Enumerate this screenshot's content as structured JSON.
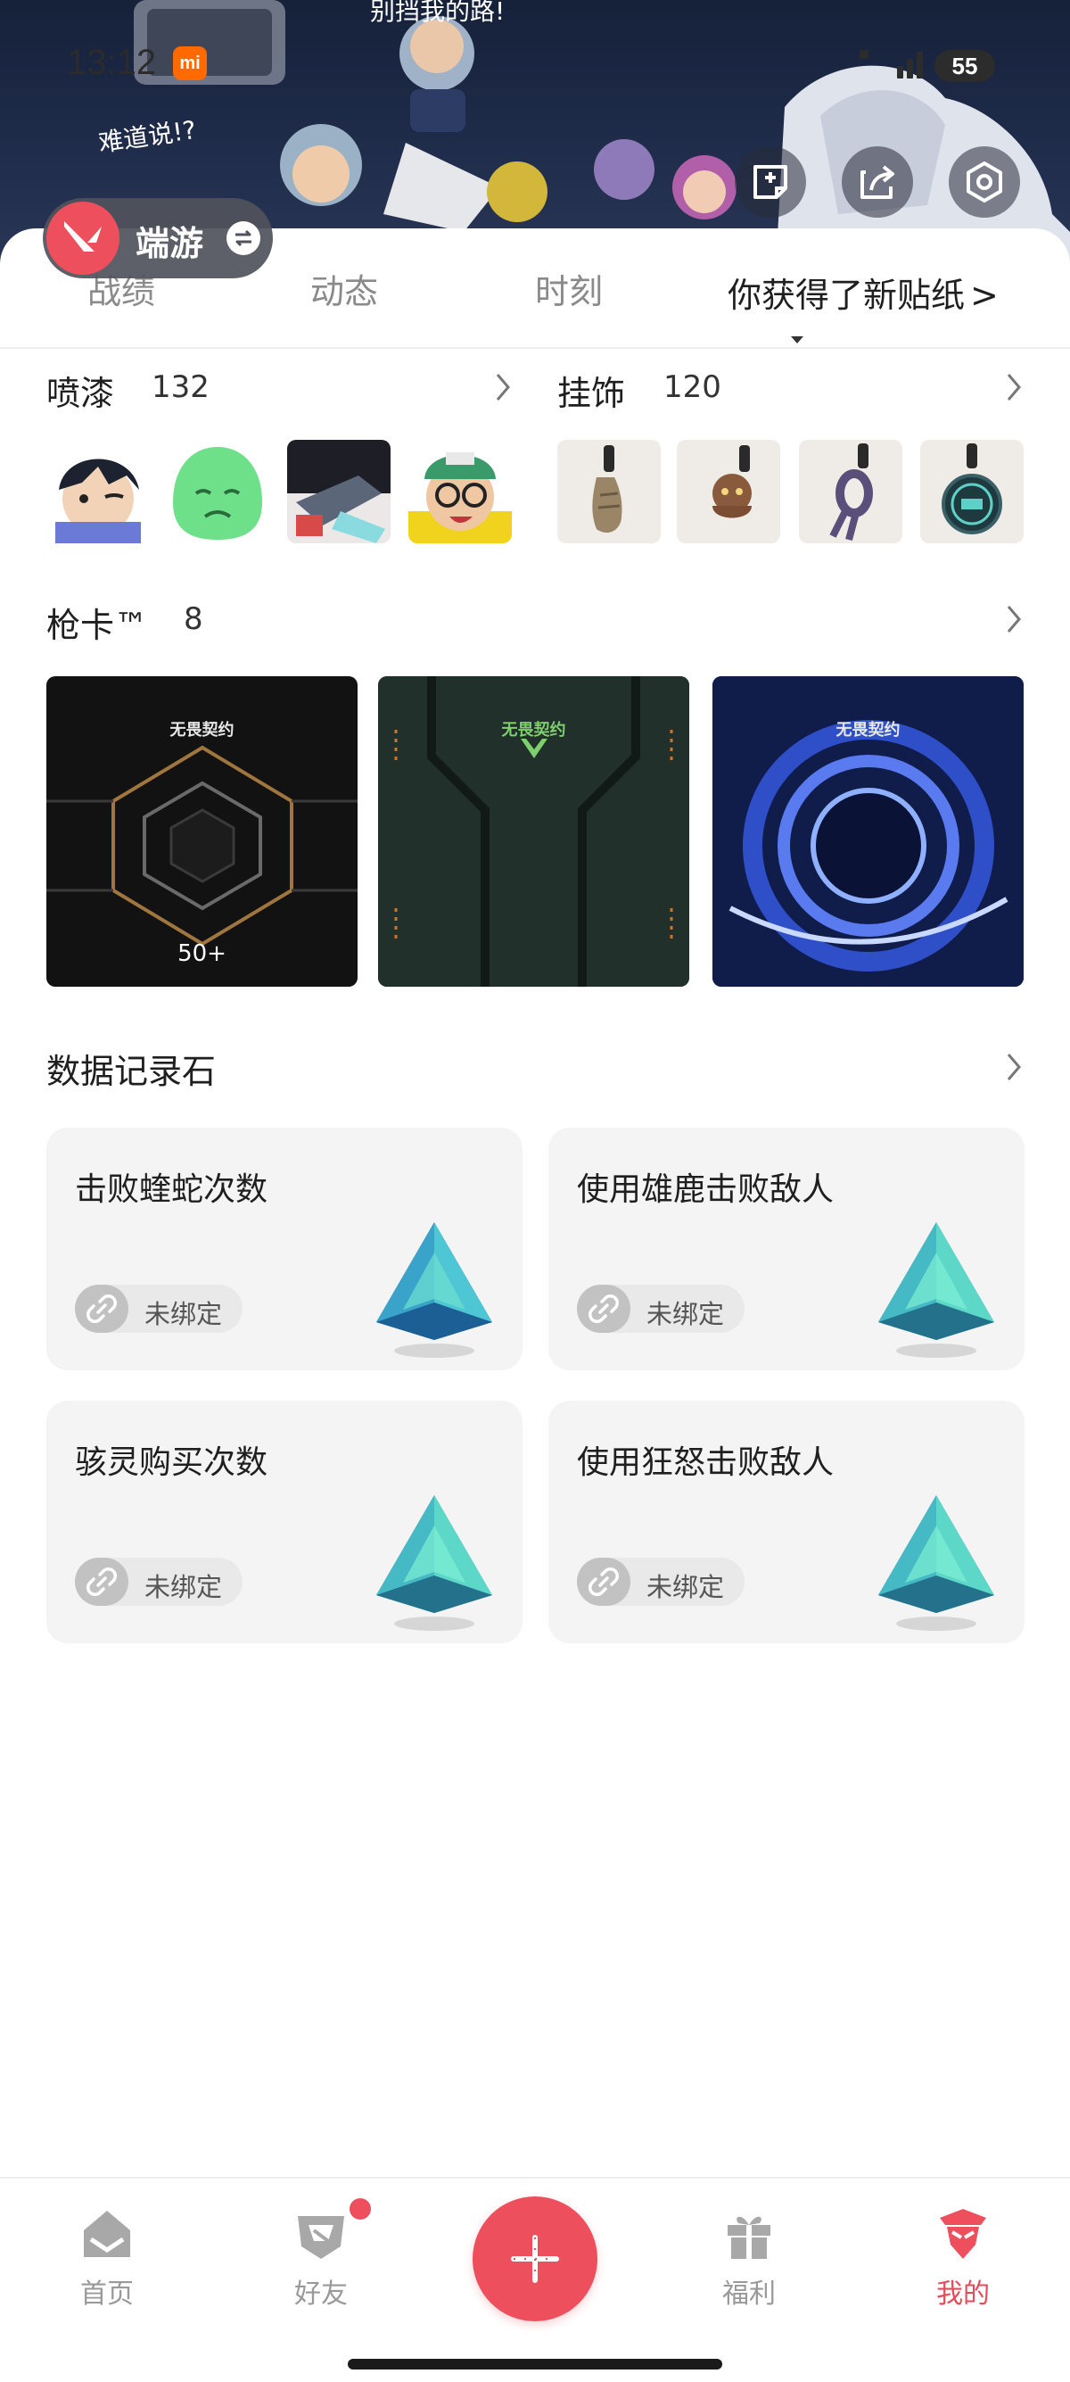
{
  "status_bar": {
    "time": "13:12",
    "mi_badge": "mi",
    "battery": "55"
  },
  "banner": {
    "art_texts": [
      "别挡我的路!",
      "难道说!?"
    ],
    "game_name": "端游"
  },
  "tabs": [
    {
      "label": "战绩"
    },
    {
      "label": "动态"
    },
    {
      "label": "时刻"
    }
  ],
  "new_sticker": {
    "label": "你获得了新贴纸",
    "chevron": ">"
  },
  "sprays": {
    "title": "喷漆",
    "count": "132"
  },
  "charms": {
    "title": "挂饰",
    "count": "120"
  },
  "gun_cards": {
    "title": "枪卡™",
    "count": "8",
    "cards": [
      {
        "brand": "无畏契约",
        "caption": "50+"
      },
      {
        "brand": "无畏契约",
        "caption": ""
      },
      {
        "brand": "无畏契约",
        "caption": ""
      }
    ]
  },
  "data_stones": {
    "title": "数据记录石",
    "items": [
      {
        "title": "击败蝰蛇次数",
        "tag": "未绑定"
      },
      {
        "title": "使用雄鹿击败敌人",
        "tag": "未绑定"
      },
      {
        "title": "骇灵购买次数",
        "tag": "未绑定"
      },
      {
        "title": "使用狂怒击败敌人",
        "tag": "未绑定"
      }
    ]
  },
  "bottom_nav": [
    {
      "label": "首页"
    },
    {
      "label": "好友"
    },
    {
      "label": "福利"
    },
    {
      "label": "我的"
    }
  ],
  "colors": {
    "accent": "#ee4f5c",
    "card_bg": "#f4f4f4",
    "muted": "#999999"
  }
}
